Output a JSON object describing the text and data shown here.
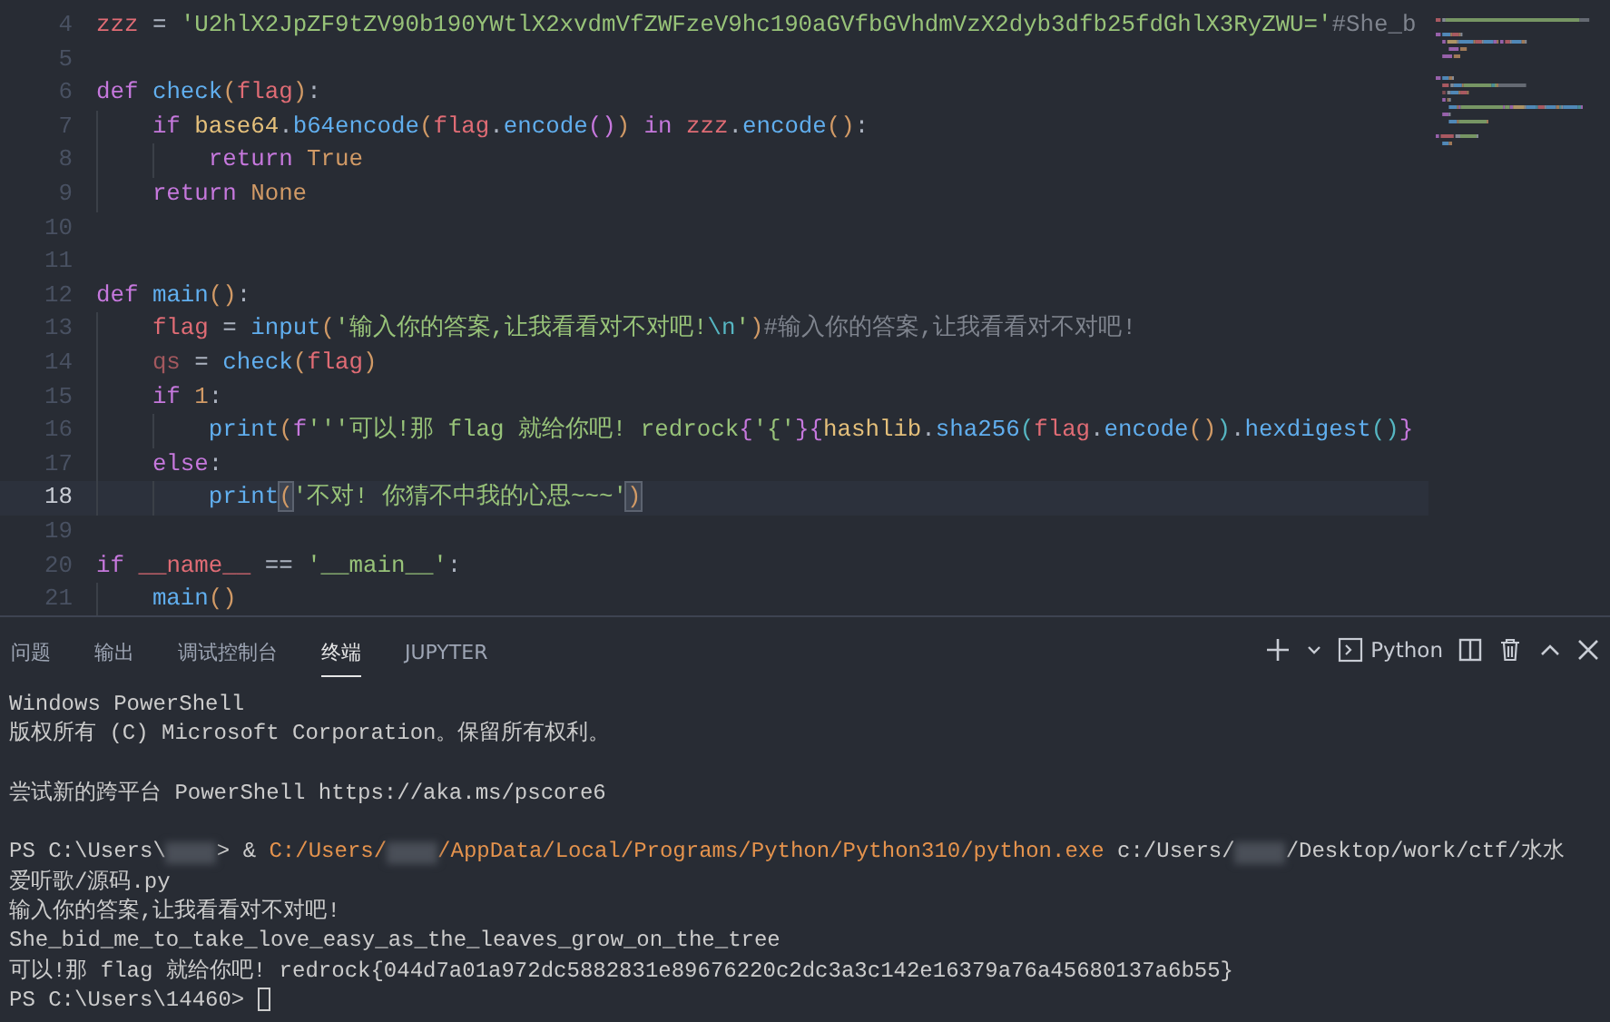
{
  "editor": {
    "lines": [
      {
        "number": "4",
        "current": false,
        "tokens": [
          {
            "kind": "var",
            "text": "zzz"
          },
          {
            "kind": "plain",
            "text": " = "
          },
          {
            "kind": "str",
            "text": "'U2hlX2JpZF9tZV90b190YWtlX2xvdmVfZWFzeV9hc190aGVfbGVhdmVzX2dyb3dfb25fdGhlX3RyZWU='"
          },
          {
            "kind": "comment",
            "text": "#She_b"
          }
        ]
      },
      {
        "number": "5",
        "current": false
      },
      {
        "number": "6",
        "current": false,
        "tokens": [
          {
            "kind": "kw",
            "text": "def"
          },
          {
            "kind": "fn",
            "text": " check"
          },
          {
            "kind": "b1",
            "text": "("
          },
          {
            "kind": "var",
            "text": "flag"
          },
          {
            "kind": "b1",
            "text": ")"
          },
          {
            "kind": "plain",
            "text": ":"
          }
        ]
      },
      {
        "number": "7",
        "current": false,
        "tokens": [
          {
            "kind": "kw",
            "text": "    if"
          },
          {
            "kind": "cls",
            "text": " base64"
          },
          {
            "kind": "plain",
            "text": "."
          },
          {
            "kind": "fn",
            "text": "b64encode"
          },
          {
            "kind": "b1",
            "text": "("
          },
          {
            "kind": "var",
            "text": "flag"
          },
          {
            "kind": "plain",
            "text": "."
          },
          {
            "kind": "fn",
            "text": "encode"
          },
          {
            "kind": "b2",
            "text": "()"
          },
          {
            "kind": "b1",
            "text": ")"
          },
          {
            "kind": "kw",
            "text": " in"
          },
          {
            "kind": "var",
            "text": " zzz"
          },
          {
            "kind": "plain",
            "text": "."
          },
          {
            "kind": "fn",
            "text": "encode"
          },
          {
            "kind": "b1",
            "text": "()"
          },
          {
            "kind": "plain",
            "text": ":"
          }
        ]
      },
      {
        "number": "8",
        "current": false,
        "tokens": [
          {
            "kind": "kw",
            "text": "        return"
          },
          {
            "kind": "num",
            "text": " True"
          }
        ]
      },
      {
        "number": "9",
        "current": false,
        "tokens": [
          {
            "kind": "kw",
            "text": "    return"
          },
          {
            "kind": "num",
            "text": " None"
          }
        ]
      },
      {
        "number": "10",
        "current": false
      },
      {
        "number": "11",
        "current": false
      },
      {
        "number": "12",
        "current": false,
        "tokens": [
          {
            "kind": "kw",
            "text": "def"
          },
          {
            "kind": "fn",
            "text": " main"
          },
          {
            "kind": "b1",
            "text": "()"
          },
          {
            "kind": "plain",
            "text": ":"
          }
        ]
      },
      {
        "number": "13",
        "current": false,
        "tokens": [
          {
            "kind": "var",
            "text": "    flag"
          },
          {
            "kind": "plain",
            "text": " = "
          },
          {
            "kind": "fn",
            "text": "input"
          },
          {
            "kind": "b1",
            "text": "("
          },
          {
            "kind": "str",
            "text": "'输入你的答案,让我看看对不对吧!"
          },
          {
            "kind": "esc",
            "text": "\\n"
          },
          {
            "kind": "str",
            "text": "'"
          },
          {
            "kind": "b1",
            "text": ")"
          },
          {
            "kind": "comment",
            "text": "#输入你的答案,让我看看对不对吧!"
          }
        ]
      },
      {
        "number": "14",
        "current": false,
        "tokens": [
          {
            "kind": "dimvar",
            "text": "    qs"
          },
          {
            "kind": "plain",
            "text": " = "
          },
          {
            "kind": "fn",
            "text": "check"
          },
          {
            "kind": "b1",
            "text": "("
          },
          {
            "kind": "var",
            "text": "flag"
          },
          {
            "kind": "b1",
            "text": ")"
          }
        ]
      },
      {
        "number": "15",
        "current": false,
        "tokens": [
          {
            "kind": "kw",
            "text": "    if"
          },
          {
            "kind": "num",
            "text": " 1"
          },
          {
            "kind": "plain",
            "text": ":"
          }
        ]
      },
      {
        "number": "16",
        "current": false,
        "tokens": [
          {
            "kind": "fn",
            "text": "        print"
          },
          {
            "kind": "b1",
            "text": "("
          },
          {
            "kind": "kw",
            "text": "f"
          },
          {
            "kind": "str",
            "text": "'''可以!那 flag 就给你吧! redrock"
          },
          {
            "kind": "b2",
            "text": "{"
          },
          {
            "kind": "str",
            "text": "'{'"
          },
          {
            "kind": "b2",
            "text": "}{"
          },
          {
            "kind": "cls",
            "text": "hashlib"
          },
          {
            "kind": "plain",
            "text": "."
          },
          {
            "kind": "fn",
            "text": "sha256"
          },
          {
            "kind": "b3",
            "text": "("
          },
          {
            "kind": "var",
            "text": "flag"
          },
          {
            "kind": "plain",
            "text": "."
          },
          {
            "kind": "fn",
            "text": "encode"
          },
          {
            "kind": "b1",
            "text": "()"
          },
          {
            "kind": "b3",
            "text": ")"
          },
          {
            "kind": "plain",
            "text": "."
          },
          {
            "kind": "fn",
            "text": "hexdigest"
          },
          {
            "kind": "b3",
            "text": "()"
          },
          {
            "kind": "b2",
            "text": "}"
          }
        ]
      },
      {
        "number": "17",
        "current": false,
        "tokens": [
          {
            "kind": "kw",
            "text": "    else"
          },
          {
            "kind": "plain",
            "text": ":"
          }
        ]
      },
      {
        "number": "18",
        "current": true,
        "tokens": [
          {
            "kind": "fn",
            "text": "        print"
          },
          {
            "kind": "match",
            "text": "("
          },
          {
            "kind": "str",
            "text": "'不对! 你猜不中我的心思~~~'"
          },
          {
            "kind": "match",
            "text": ")"
          }
        ]
      },
      {
        "number": "19",
        "current": false
      },
      {
        "number": "20",
        "current": false,
        "tokens": [
          {
            "kind": "kw",
            "text": "if"
          },
          {
            "kind": "var",
            "text": " __name__"
          },
          {
            "kind": "plain",
            "text": " == "
          },
          {
            "kind": "str",
            "text": "'__main__'"
          },
          {
            "kind": "plain",
            "text": ":"
          }
        ]
      },
      {
        "number": "21",
        "current": false,
        "tokens": [
          {
            "kind": "fn",
            "text": "    main"
          },
          {
            "kind": "b1",
            "text": "()"
          }
        ]
      }
    ]
  },
  "panel": {
    "tabs": [
      {
        "label": "问题",
        "selected": false
      },
      {
        "label": "输出",
        "selected": false
      },
      {
        "label": "调试控制台",
        "selected": false
      },
      {
        "label": "终端",
        "selected": true
      },
      {
        "label": "JUPYTER",
        "selected": false
      }
    ],
    "terminal_label": "Python",
    "terminal_lines": [
      {
        "blank_before": false,
        "segments": [
          {
            "kind": "text",
            "text": "Windows PowerShell"
          }
        ]
      },
      {
        "blank_before": false,
        "segments": [
          {
            "kind": "text",
            "text": "版权所有 (C) Microsoft Corporation。保留所有权利。"
          }
        ]
      },
      {
        "blank_before": true,
        "segments": [
          {
            "kind": "text",
            "text": "尝试新的跨平台 PowerShell https://aka.ms/pscore6"
          }
        ]
      },
      {
        "blank_before": true,
        "segments": [
          {
            "kind": "text",
            "text": "PS C:\\Users\\"
          },
          {
            "kind": "redacted"
          },
          {
            "kind": "text",
            "text": "> & "
          },
          {
            "kind": "path",
            "text": "C:/Users/"
          },
          {
            "kind": "redacted"
          },
          {
            "kind": "path",
            "text": "/AppData/Local/Programs/Python/Python310/python.exe"
          },
          {
            "kind": "text",
            "text": " c:/Users/"
          },
          {
            "kind": "redacted"
          },
          {
            "kind": "text",
            "text": "/Desktop/work/ctf/水水"
          }
        ]
      },
      {
        "blank_before": false,
        "segments": [
          {
            "kind": "text",
            "text": "爱听歌/源码.py"
          }
        ]
      },
      {
        "blank_before": false,
        "segments": [
          {
            "kind": "text",
            "text": "输入你的答案,让我看看对不对吧!"
          }
        ]
      },
      {
        "blank_before": false,
        "segments": [
          {
            "kind": "text",
            "text": "She_bid_me_to_take_love_easy_as_the_leaves_grow_on_the_tree"
          }
        ]
      },
      {
        "blank_before": false,
        "segments": [
          {
            "kind": "text",
            "text": "可以!那 flag 就给你吧! redrock{044d7a01a972dc5882831e89676220c2dc3a3c142e16379a76a45680137a6b55}"
          }
        ]
      },
      {
        "blank_before": false,
        "segments": [
          {
            "kind": "text",
            "text": "PS C:\\Users\\14460> "
          },
          {
            "kind": "cursor"
          }
        ]
      }
    ]
  }
}
